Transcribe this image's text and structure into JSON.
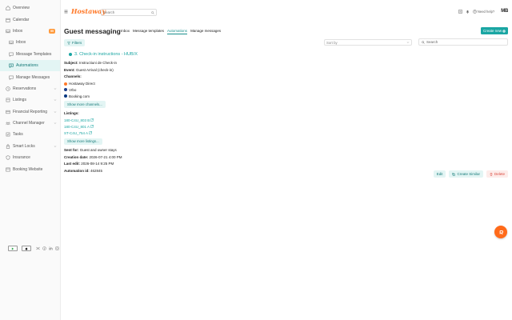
{
  "sidebar": {
    "items": [
      {
        "label": "Overview",
        "icon": "home-icon"
      },
      {
        "label": "Calendar",
        "icon": "calendar-icon"
      },
      {
        "label": "Inbox",
        "icon": "inbox-icon",
        "badge": "99"
      },
      {
        "label": "Inbox",
        "icon": "inbox-icon",
        "sub": true
      },
      {
        "label": "Message Templates",
        "icon": "template-icon",
        "sub": true
      },
      {
        "label": "Automations",
        "icon": "automation-icon",
        "sub": true,
        "active": true
      },
      {
        "label": "Manage Messages",
        "icon": "message-icon",
        "sub": true
      },
      {
        "label": "Reservations",
        "icon": "reservations-icon"
      },
      {
        "label": "Listings",
        "icon": "listings-icon"
      },
      {
        "label": "Financial Reporting",
        "icon": "finance-icon"
      },
      {
        "label": "Channel Manager",
        "icon": "channel-icon"
      },
      {
        "label": "Tasks",
        "icon": "tasks-icon"
      },
      {
        "label": "Smart Locks",
        "icon": "lock-icon"
      },
      {
        "label": "Insurance",
        "icon": "insurance-icon"
      },
      {
        "label": "Booking Website",
        "icon": "website-icon"
      }
    ]
  },
  "header": {
    "logo": "Hostaway",
    "search_placeholder": "Search",
    "help": "Need help?",
    "avatar": "MB"
  },
  "main": {
    "title": "Guest messaging",
    "tabs": [
      {
        "label": "Inbox"
      },
      {
        "label": "Message templates"
      },
      {
        "label": "Automations",
        "active": true
      },
      {
        "label": "Manage messages"
      }
    ],
    "create_new": "Create new",
    "filters": "Filters",
    "sort_by": "Sort by",
    "search_placeholder": "Search",
    "rule": {
      "title": "3. Check-in instructions - HUB/X",
      "subject_label": "Subject:",
      "subject": "Instructiuni de Check-in",
      "event_label": "Event:",
      "event": "Guest Arrival (check-in)",
      "channels_label": "Channels:",
      "channels": [
        {
          "name": "Hostaway Direct",
          "color": "#ff7a2a"
        },
        {
          "name": "Vrbo",
          "color": "#1d3f8a"
        },
        {
          "name": "Booking.com",
          "color": "#003580"
        }
      ],
      "more_channels": "Show more channels...",
      "listings_label": "Listings:",
      "listings": [
        "180-C4U_803 B",
        "180-C4U_801 A",
        "ST-C4U_754 A"
      ],
      "more_listings": "Show more listings...",
      "sent_for_label": "Sent for:",
      "sent_for": "Guest and owner stays",
      "creation_label": "Creation date:",
      "creation": "2026-07-21 4:00 PM",
      "last_edit_label": "Last edit:",
      "last_edit": "2026-08-14 9:25 PM",
      "automation_id_label": "Automation id:",
      "automation_id": "462845"
    },
    "actions": {
      "edit": "Edit",
      "create_similar": "Create Similar",
      "delete": "Delete"
    }
  },
  "colors": {
    "accent": "#1aa6a3",
    "brand": "#ff7a2a",
    "danger": "#d9443a"
  }
}
